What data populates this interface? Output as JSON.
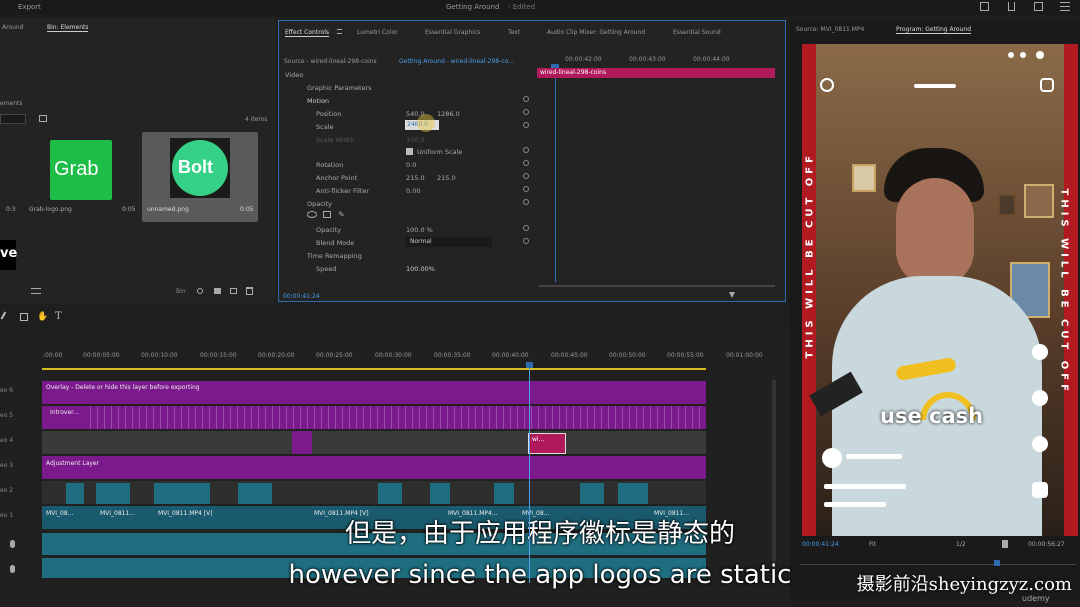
{
  "topbar": {
    "menu": "Export",
    "title": "Getting Around",
    "edited": "- Edited"
  },
  "project": {
    "tab_left": "Around",
    "tab_bin": "Bin: Elements",
    "label_elements": "ements",
    "items_count": "4 items",
    "items": [
      {
        "name": "Grab-logo.png",
        "duration": "0:05",
        "logo": "Grab"
      },
      {
        "name": "unnamed.png",
        "duration": "0:05",
        "logo": "Bolt"
      }
    ],
    "left_duration": "0:3",
    "partial_logo": "ve"
  },
  "effects": {
    "tabs": [
      "Effect Controls",
      "Lumetri Color",
      "Essential Graphics",
      "Text",
      "Audio Clip Mixer: Getting Around",
      "Essential Sound"
    ],
    "source": "Source - wired-lineal-298-coins",
    "sequence": "Getting Around - wired-lineal-298-co...",
    "timecodes": [
      "00:00:42:00",
      "00:00:43:00",
      "00:00:44:00"
    ],
    "clip_label": "wired-lineal-298-coins",
    "video_label": "Video",
    "graphic_params": "Graphic Parameters",
    "motion": "Motion",
    "position": {
      "label": "Position",
      "x": "540.0",
      "y": "1286.0"
    },
    "scale": {
      "label": "Scale",
      "value": "2460.0"
    },
    "scale_width": {
      "label": "Scale Width",
      "value": "100.0"
    },
    "uniform_scale": "Uniform Scale",
    "rotation": {
      "label": "Rotation",
      "value": "0.0"
    },
    "anchor": {
      "label": "Anchor Point",
      "x": "215.0",
      "y": "215.0"
    },
    "antiflicker": {
      "label": "Anti-flicker Filter",
      "value": "0.00"
    },
    "opacity_section": "Opacity",
    "opacity": {
      "label": "Opacity",
      "value": "100.0 %"
    },
    "blend": {
      "label": "Blend Mode",
      "value": "Normal"
    },
    "time_remap": "Time Remapping",
    "speed": {
      "label": "Speed",
      "value": "100.00%"
    },
    "current_time": "00:00:41:24"
  },
  "program": {
    "source_tab": "Source: MVI_0811.MP4",
    "program_tab": "Program: Getting Around",
    "overlay_text": "THIS WILL BE CUT OFF",
    "caption": "use cash",
    "timecode": "00:00:41:24",
    "fit": "Fit",
    "res": "1/2",
    "duration": "00:00:56:27"
  },
  "timeline": {
    "ruler": [
      ":00:00",
      "00:00:05:00",
      "00:00:10:00",
      "00:00:15:00",
      "00:00:20:00",
      "00:00:25:00",
      "00:00:30:00",
      "00:00:35:00",
      "00:00:40:00",
      "00:00:45:00",
      "00:00:50:00",
      "00:00:55:00",
      "00:01:00:00"
    ],
    "tracks": [
      "eo 6",
      "eo 5",
      "eo 4",
      "eo 3",
      "eo 2",
      "eo 1"
    ],
    "overlay_clip": "Overlay - Delete or hide this layer before exporting",
    "intro_clip": "Introver...",
    "adjustment_clip": "Adjustment Layer",
    "wi_clip": "wi...",
    "v1_clips": [
      "MVI_08...",
      "MVI_0811...",
      "MVI_0811.MP4 [V]",
      "MVI_0811.MP4 [V]",
      "MVI_0811.MP4...",
      "MVI_08...",
      "MVI_0811..."
    ]
  },
  "subtitles": {
    "cn": "但是，由于应用程序徽标是静态的",
    "en": "however since the app logos are static"
  },
  "watermark": "摄影前沿sheyingzyz.com",
  "udemy": "udemy"
}
